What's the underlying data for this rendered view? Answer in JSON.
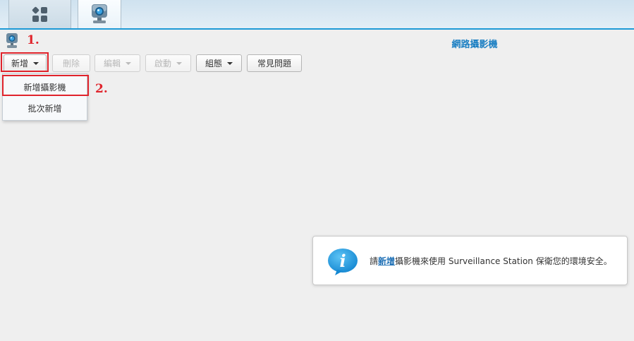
{
  "header": {
    "title": "網路攝影機"
  },
  "tabs": [
    {
      "icon": "apps-grid-icon"
    },
    {
      "icon": "camera-icon"
    }
  ],
  "markers": {
    "step1": "1.",
    "step2": "2."
  },
  "toolbar": {
    "add": "新增",
    "delete": "刪除",
    "edit": "編輯",
    "enable": "啟動",
    "config": "組態",
    "faq": "常見問題"
  },
  "add_menu": {
    "items": [
      "新增攝影機",
      "批次新增"
    ]
  },
  "info": {
    "prefix": "請",
    "link": "新增",
    "suffix": "攝影機來使用 Surveillance Station 保衛您的環境安全。"
  },
  "colors": {
    "accent": "#1e9ad6",
    "title": "#1d80c3",
    "highlight": "#e0242c"
  }
}
